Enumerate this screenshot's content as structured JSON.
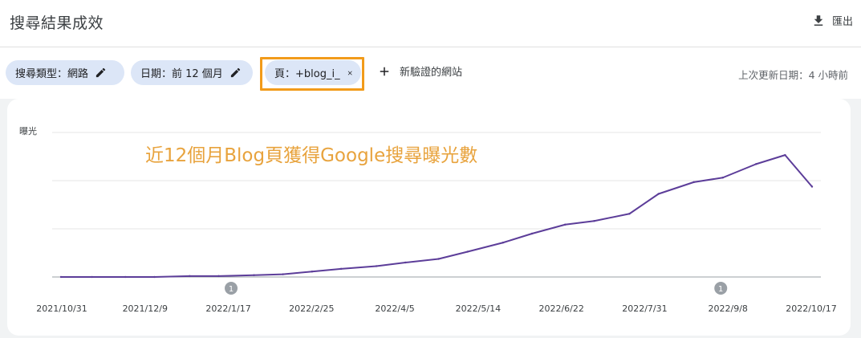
{
  "header": {
    "title": "搜尋結果成效",
    "export_label": "匯出"
  },
  "filters": {
    "chips": [
      {
        "label": "搜尋類型：網路",
        "icon": "pencil-icon"
      },
      {
        "label": "日期：前 12 個月",
        "icon": "pencil-icon"
      },
      {
        "label": "頁：+blog_i_",
        "icon": "close-icon"
      }
    ],
    "add_compare_label": "新驗證的網站",
    "last_update": "上次更新日期：4 小時前"
  },
  "colors": {
    "line": "#5c3d99",
    "annotation_text": "#e8a33d",
    "highlight_border": "#f29b1a",
    "chip_bg": "#dce6f7"
  },
  "chart_data": {
    "type": "line",
    "ylabel": "曝光",
    "annotation": "近12個月Blog頁獲得Google搜尋曝光數",
    "x_tick_labels": [
      "2021/10/31",
      "2021/12/9",
      "2022/1/17",
      "2022/2/25",
      "2022/4/5",
      "2022/5/14",
      "2022/6/22",
      "2022/7/31",
      "2022/9/8",
      "2022/10/17"
    ],
    "event_markers": [
      {
        "label": "1",
        "date": "2022/1/21"
      },
      {
        "label": "1",
        "date": "2022/9/14"
      }
    ],
    "x": [
      "2021/10/31",
      "2021/11/15",
      "2021/12/1",
      "2021/12/15",
      "2022/1/1",
      "2022/1/15",
      "2022/2/1",
      "2022/2/15",
      "2022/3/1",
      "2022/3/15",
      "2022/4/1",
      "2022/4/15",
      "2022/5/1",
      "2022/5/15",
      "2022/6/1",
      "2022/6/15",
      "2022/7/1",
      "2022/7/15",
      "2022/8/1",
      "2022/8/15",
      "2022/9/1",
      "2022/9/15",
      "2022/10/1",
      "2022/10/15",
      "2022/10/28"
    ],
    "values": [
      0,
      0,
      0,
      0,
      1,
      1,
      2,
      3,
      6,
      9,
      12,
      16,
      20,
      28,
      38,
      48,
      58,
      62,
      70,
      92,
      105,
      110,
      125,
      135,
      100
    ],
    "ylim": [
      0,
      160
    ],
    "grid": true
  }
}
